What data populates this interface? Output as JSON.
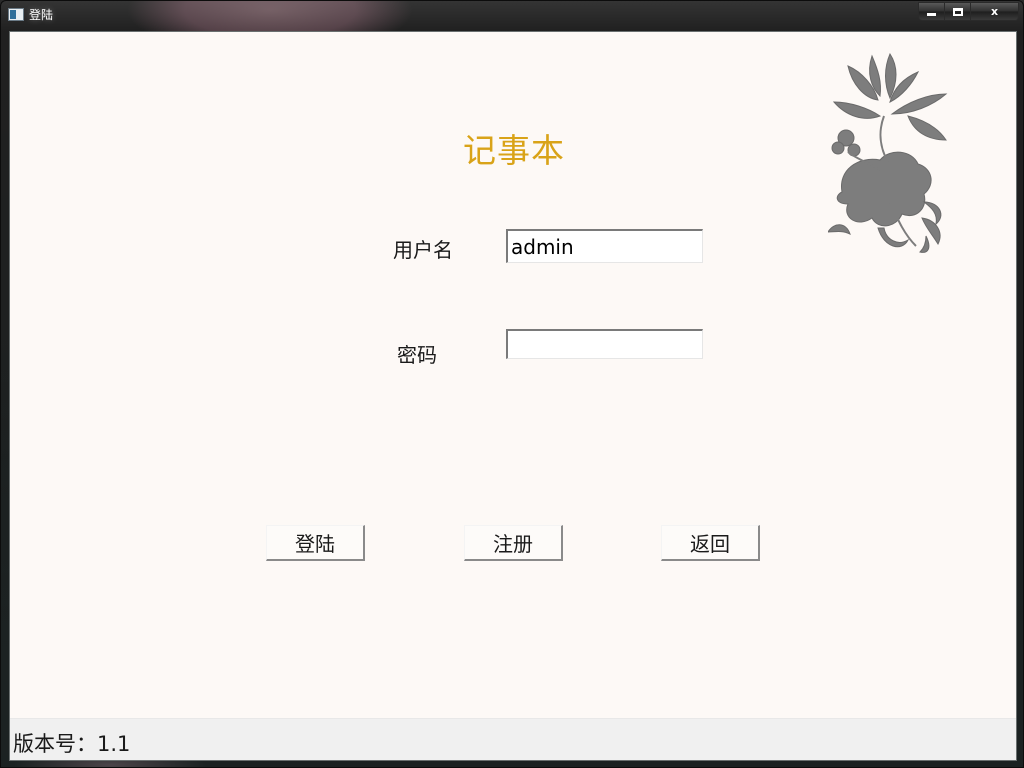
{
  "window": {
    "title": "登陆",
    "icon": "window-app-icon",
    "caption_buttons": {
      "minimize_icon": "minimize-icon",
      "maximize_icon": "maximize-icon",
      "close_label": "x"
    }
  },
  "main": {
    "heading": "记事本",
    "heading_color": "#d9a318",
    "decoration_icon": "lotus-flower-icon"
  },
  "form": {
    "username_label": "用户名",
    "username_value": "admin",
    "password_label": "密码",
    "password_value": ""
  },
  "buttons": {
    "login_label": "登陆",
    "register_label": "注册",
    "back_label": "返回"
  },
  "status_bar": {
    "version_text": "版本号：1.1"
  }
}
